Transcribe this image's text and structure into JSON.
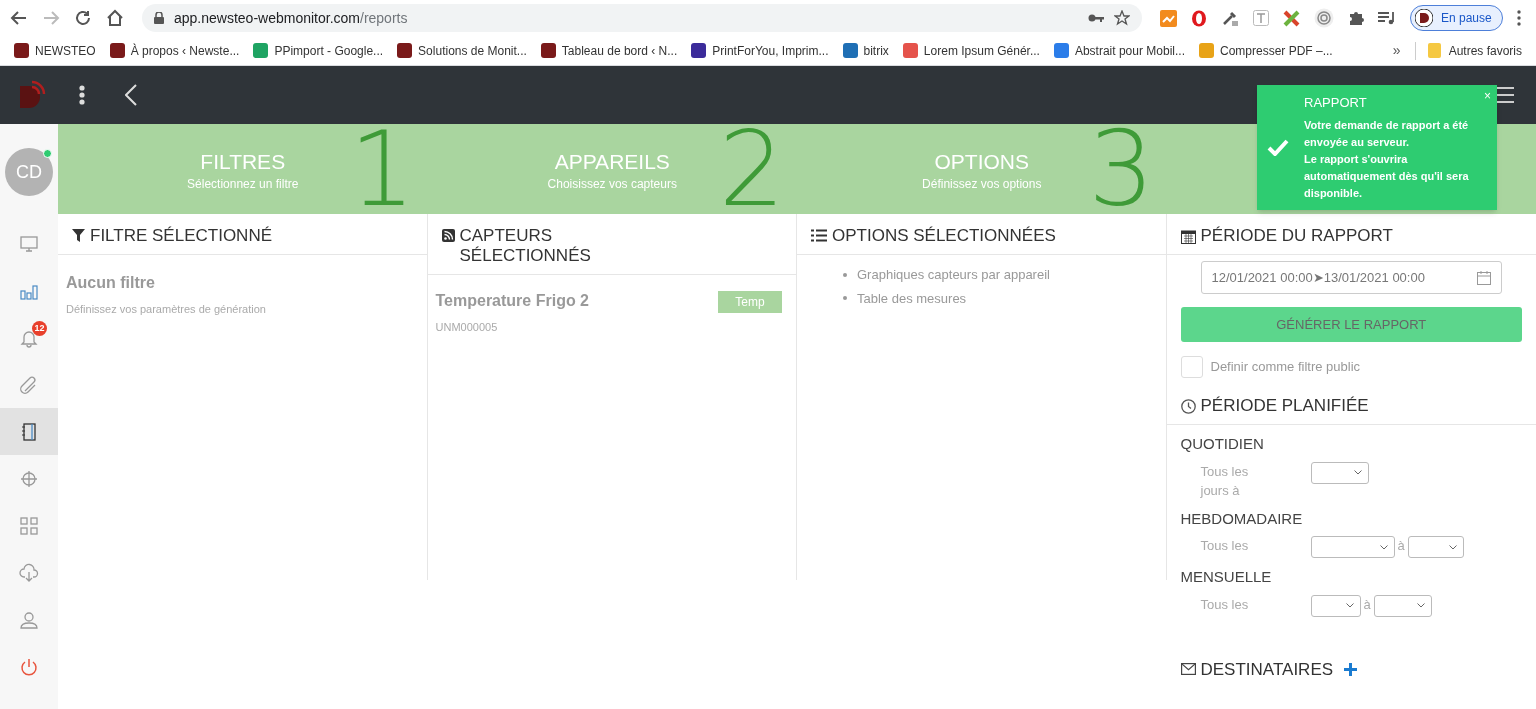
{
  "browser": {
    "url_host": "app.newsteo-webmonitor.com",
    "url_path": "/reports",
    "profile_label": "En pause",
    "bookmarks": [
      {
        "label": "NEWSTEO",
        "color": "#7a1a1a"
      },
      {
        "label": "À propos ‹ Newste...",
        "color": "#7a1a1a"
      },
      {
        "label": "PPimport - Google...",
        "color": "#1fa463"
      },
      {
        "label": "Solutions de Monit...",
        "color": "#7a1a1a"
      },
      {
        "label": "Tableau de bord ‹ N...",
        "color": "#7a1a1a"
      },
      {
        "label": "PrintForYou, Imprim...",
        "color": "#3b2b9a"
      },
      {
        "label": "bitrix",
        "color": "#1f6fb5"
      },
      {
        "label": "Lorem Ipsum Génér...",
        "color": "#e5534b"
      },
      {
        "label": "Abstrait pour Mobil...",
        "color": "#2b7de9"
      },
      {
        "label": "Compresser PDF –...",
        "color": "#e8a317"
      }
    ],
    "more": "»",
    "other_bookmarks": "Autres favoris"
  },
  "sidebar": {
    "avatar": {
      "initials": "CD",
      "online": true
    },
    "items": [
      {
        "selected": false
      },
      {
        "selected": false
      },
      {
        "selected": false,
        "badge": "12"
      },
      {
        "selected": false
      },
      {
        "selected": true
      },
      {
        "selected": false
      },
      {
        "selected": false
      },
      {
        "selected": false
      },
      {
        "selected": false
      },
      {
        "selected": false
      }
    ]
  },
  "steps": [
    {
      "title": "FILTRES",
      "subtitle": "Sélectionnez un filtre",
      "number": "1"
    },
    {
      "title": "APPAREILS",
      "subtitle": "Choisissez vos capteurs",
      "number": "2"
    },
    {
      "title": "OPTIONS",
      "subtitle": "Définissez vos options",
      "number": "3"
    }
  ],
  "filter_panel": {
    "title": "FILTRE SÉLECTIONNÉ",
    "name": "Aucun filtre",
    "hint": "Définissez vos paramètres de génération"
  },
  "sensors_panel": {
    "title": "CAPTEURS SÉLECTIONNÉS",
    "sensors": [
      {
        "name": "Temperature Frigo 2",
        "id": "UNM000005",
        "tag": "Temp"
      }
    ]
  },
  "options_panel": {
    "title": "OPTIONS SÉLECTIONNÉES",
    "options": [
      "Graphiques capteurs par appareil",
      "Table des mesures"
    ]
  },
  "report_panel": {
    "title": "PÉRIODE DU RAPPORT",
    "date_range": "12/01/2021 00:00➤13/01/2021 00:00",
    "generate_button": "GÉNÉRER LE RAPPORT",
    "public_filter": {
      "label": "Definir comme filtre public",
      "checked": false
    },
    "schedule_title": "PÉRIODE PLANIFIÉE",
    "schedules": [
      {
        "title": "QUOTIDIEN",
        "label": "Tous les jours à"
      },
      {
        "title": "HEBDOMADAIRE",
        "label": "Tous les",
        "separator": "à"
      },
      {
        "title": "MENSUELLE",
        "label": "Tous les",
        "separator": "à"
      }
    ],
    "recipients_title": "DESTINATAIRES"
  },
  "toast": {
    "title": "RAPPORT",
    "message": "Votre demande de rapport a été envoyée au serveur.\nLe rapport s'ouvrira automatiquement dès qu'il sera disponible.",
    "close": "×"
  }
}
